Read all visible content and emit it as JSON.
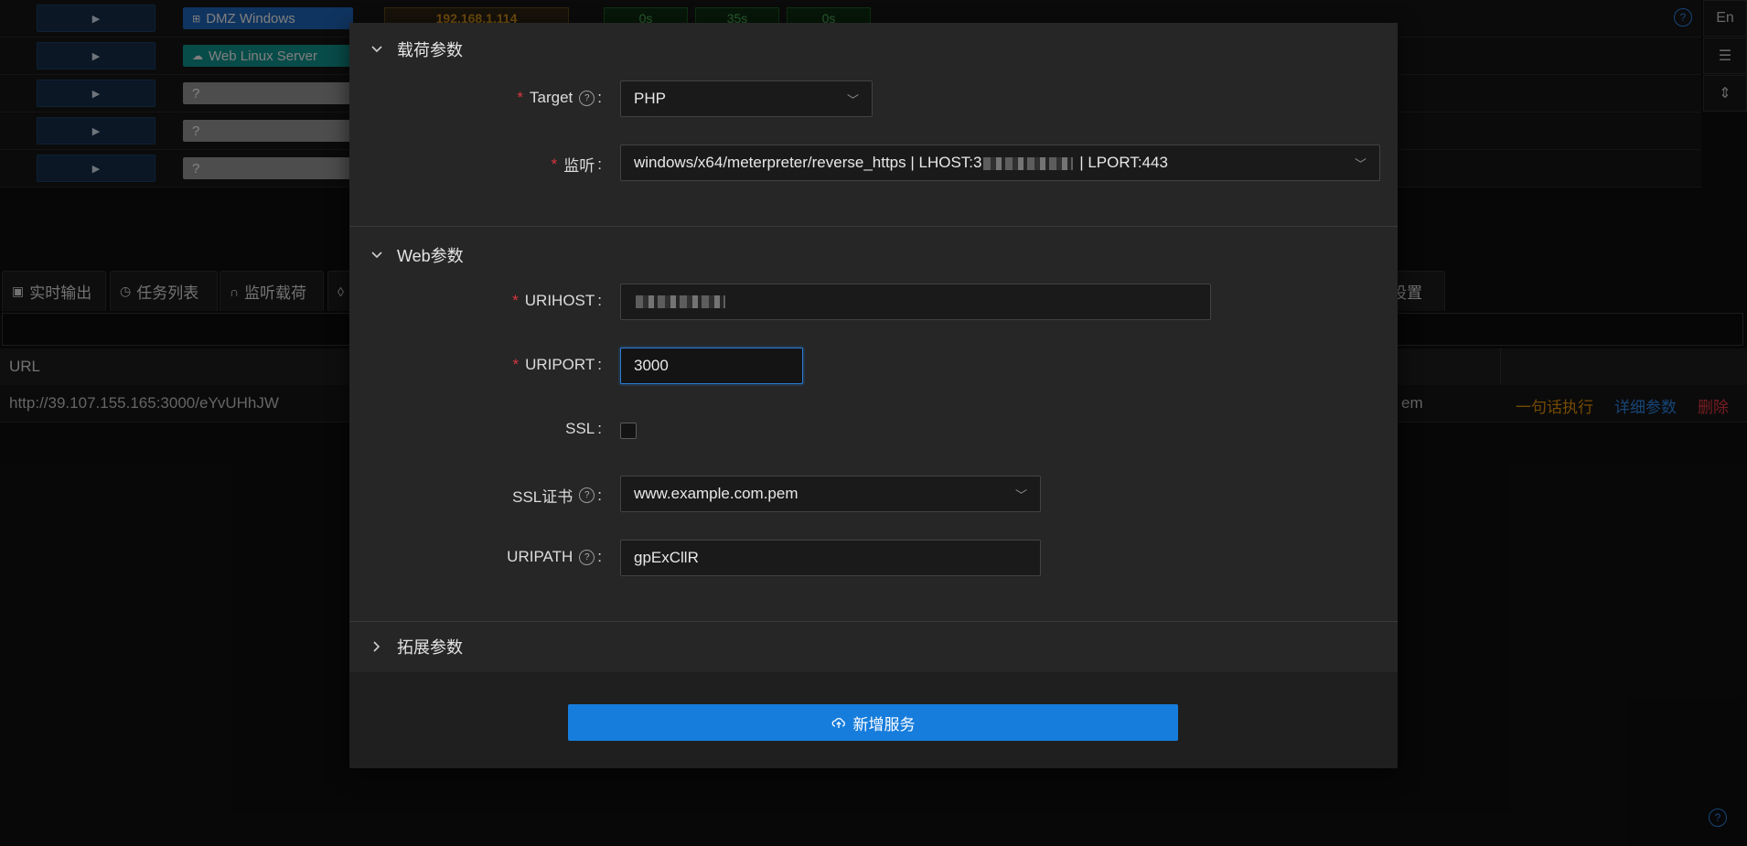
{
  "sessions": [
    {
      "label": "DMZ Windows",
      "icon": "windows-icon",
      "color": "blue",
      "ip": "192.168.1.114",
      "times": [
        "0s",
        "35s",
        "0s"
      ]
    },
    {
      "label": "Web Linux Server",
      "icon": "cloud-icon",
      "color": "teal"
    },
    {
      "label": "?",
      "color": "gray"
    },
    {
      "label": "?",
      "color": "gray"
    },
    {
      "label": "?",
      "color": "gray"
    }
  ],
  "side_buttons": {
    "lang": "En"
  },
  "tabs": [
    {
      "label": "实时输出",
      "icon": "monitor-icon"
    },
    {
      "label": "任务列表",
      "icon": "history-icon"
    },
    {
      "label": "监听载荷",
      "icon": "headphones-icon"
    },
    {
      "label": "",
      "icon": "drop-icon"
    }
  ],
  "tab_partial_right": "设置",
  "bg_table": {
    "header_url": "URL",
    "row": {
      "url": "http://39.107.155.165:3000/eYvUHhJW",
      "cert_fragment": "em",
      "actions": {
        "exec": "一句话执行",
        "detail": "详细参数",
        "delete": "删除"
      }
    }
  },
  "modal": {
    "payload_section": {
      "title": "载荷参数",
      "target_label": "Target",
      "target_value": "PHP",
      "listener_label": "监听",
      "listener_value_prefix": "windows/x64/meterpreter/reverse_https | LHOST:3",
      "listener_value_suffix": " | LPORT:443"
    },
    "web_section": {
      "title": "Web参数",
      "urihost_label": "URIHOST",
      "uriport_label": "URIPORT",
      "uriport_value": "3000",
      "ssl_label": "SSL",
      "ssl_checked": false,
      "sslcert_label": "SSL证书",
      "sslcert_value": "www.example.com.pem",
      "uripath_label": "URIPATH",
      "uripath_value": "gpExCllR"
    },
    "ext_section": {
      "title": "拓展参数"
    },
    "submit_label": "新增服务"
  },
  "colors": {
    "primary": "#177ddc",
    "required": "#d9363e",
    "warning": "#d48806",
    "danger": "#d9363e"
  }
}
